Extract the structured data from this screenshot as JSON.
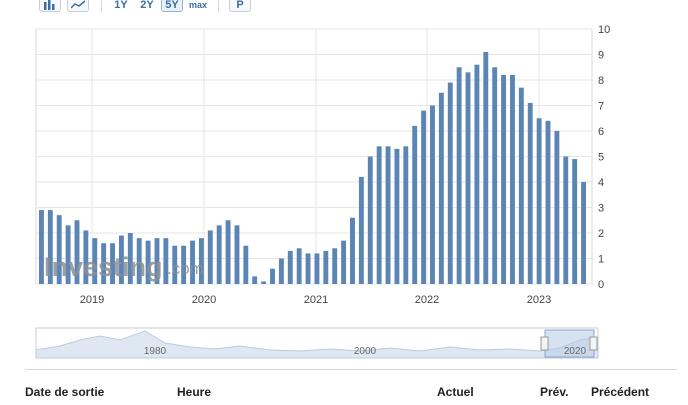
{
  "toolbar": {
    "buttons": [
      "1Y",
      "2Y",
      "5Y",
      "max",
      "P"
    ],
    "selected": "5Y"
  },
  "chart_data": {
    "type": "bar",
    "title": "",
    "color": "#5b85b5",
    "y_axis": {
      "ticks": [
        "0",
        "1",
        "2",
        "3",
        "4",
        "5",
        "6",
        "7",
        "8",
        "9",
        "10"
      ],
      "ylim": [
        0,
        10
      ],
      "position": "right"
    },
    "x_axis": {
      "ticks": [
        "2019",
        "2020",
        "2021",
        "2022",
        "2023"
      ]
    },
    "values": [
      2.9,
      2.9,
      2.7,
      2.3,
      2.5,
      2.1,
      1.8,
      1.6,
      1.6,
      1.9,
      2.0,
      1.8,
      1.7,
      1.8,
      1.8,
      1.5,
      1.5,
      1.7,
      1.8,
      2.1,
      2.3,
      2.5,
      2.3,
      1.5,
      0.3,
      0.1,
      0.6,
      1.0,
      1.3,
      1.4,
      1.2,
      1.2,
      1.3,
      1.4,
      1.7,
      2.6,
      4.2,
      5.0,
      5.4,
      5.4,
      5.3,
      5.4,
      6.2,
      6.8,
      7.0,
      7.5,
      7.9,
      8.5,
      8.3,
      8.6,
      9.1,
      8.5,
      8.2,
      8.2,
      7.7,
      7.1,
      6.5,
      6.4,
      6.0,
      5.0,
      4.9,
      4.0
    ],
    "grid": true,
    "navigator": {
      "labels": [
        "1980",
        "2000",
        "2020"
      ]
    }
  },
  "watermark": {
    "brand": "Investing",
    "suffix": ".com"
  },
  "table": {
    "headers": [
      "Date de sortie",
      "Heure",
      "Actuel",
      "Prév.",
      "Précédent"
    ]
  },
  "colors": {
    "bar": "#5b85b5",
    "accent": "#3a6ea5",
    "grid": "#e6e6e6"
  }
}
